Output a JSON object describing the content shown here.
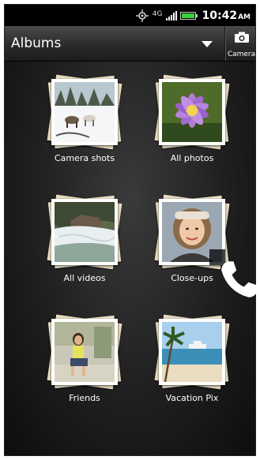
{
  "status_bar": {
    "network": "4G",
    "time": "10:42",
    "time_suffix": "AM"
  },
  "header": {
    "title": "Albums",
    "camera_label": "Camera"
  },
  "albums": [
    {
      "label": "Camera shots",
      "thumbnail": "snow-dog-sled"
    },
    {
      "label": "All photos",
      "thumbnail": "purple-flower"
    },
    {
      "label": "All videos",
      "thumbnail": "river-rapids"
    },
    {
      "label": "Close-ups",
      "thumbnail": "woman-portrait",
      "badge": "phone-icon"
    },
    {
      "label": "Friends",
      "thumbnail": "girl-sitting"
    },
    {
      "label": "Vacation Pix",
      "thumbnail": "beach-cruise-ship"
    }
  ],
  "colors": {
    "background": "#0b0b0b",
    "title_text": "#ffffff",
    "battery": "#3ccf3c"
  }
}
